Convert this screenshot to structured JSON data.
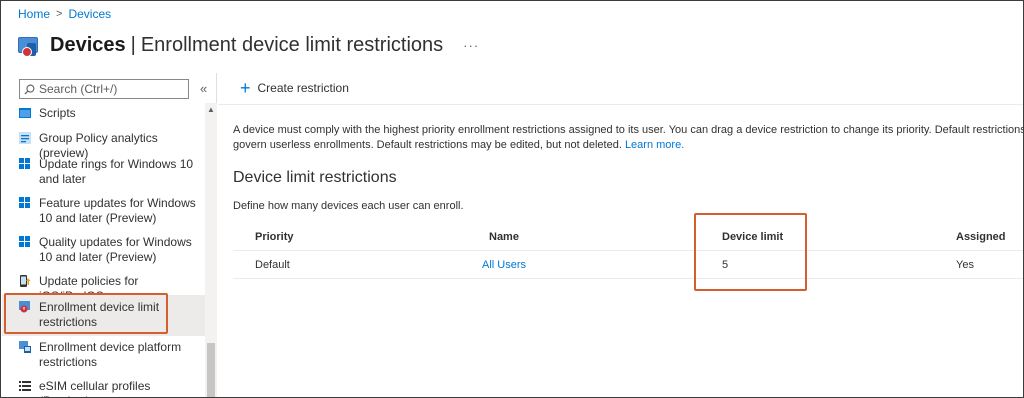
{
  "breadcrumb": {
    "home": "Home",
    "devices": "Devices",
    "separator": ">"
  },
  "header": {
    "title_bold": "Devices",
    "separator": "|",
    "title_rest": "Enrollment device limit restrictions",
    "more": "···"
  },
  "sidebar": {
    "search_placeholder": "Search (Ctrl+/)",
    "collapse": "«",
    "items": [
      {
        "label": "Scripts",
        "icon": "scripts-icon"
      },
      {
        "label": "Group Policy analytics (preview)",
        "icon": "group-policy-icon"
      },
      {
        "label": "Update rings for Windows 10 and later",
        "icon": "windows-icon"
      },
      {
        "label": "Feature updates for Windows 10 and later (Preview)",
        "icon": "windows-icon"
      },
      {
        "label": "Quality updates for Windows 10 and later (Preview)",
        "icon": "windows-icon"
      },
      {
        "label": "Update policies for iOS/iPadOS",
        "icon": "ios-update-icon"
      },
      {
        "label": "Enrollment device limit restrictions",
        "icon": "enrollment-limit-icon",
        "active": true
      },
      {
        "label": "Enrollment device platform restrictions",
        "icon": "platform-restrictions-icon"
      },
      {
        "label": "eSIM cellular profiles (Preview)",
        "icon": "esim-icon"
      }
    ]
  },
  "toolbar": {
    "create_label": "Create restriction"
  },
  "main": {
    "description": "A device must comply with the highest priority enrollment restrictions assigned to its user. You can drag a device restriction to change its priority. Default restrictions are l",
    "description_line2": "govern userless enrollments. Default restrictions may be edited, but not deleted.",
    "learn_more": "Learn more.",
    "section_title": "Device limit restrictions",
    "section_subtitle": "Define how many devices each user can enroll."
  },
  "table": {
    "columns": [
      "Priority",
      "Name",
      "Device limit",
      "Assigned"
    ],
    "rows": [
      {
        "priority": "Default",
        "name": "All Users",
        "device_limit": "5",
        "assigned": "Yes"
      }
    ]
  },
  "colors": {
    "accent": "#0078d4",
    "highlight": "#d35f2f"
  }
}
